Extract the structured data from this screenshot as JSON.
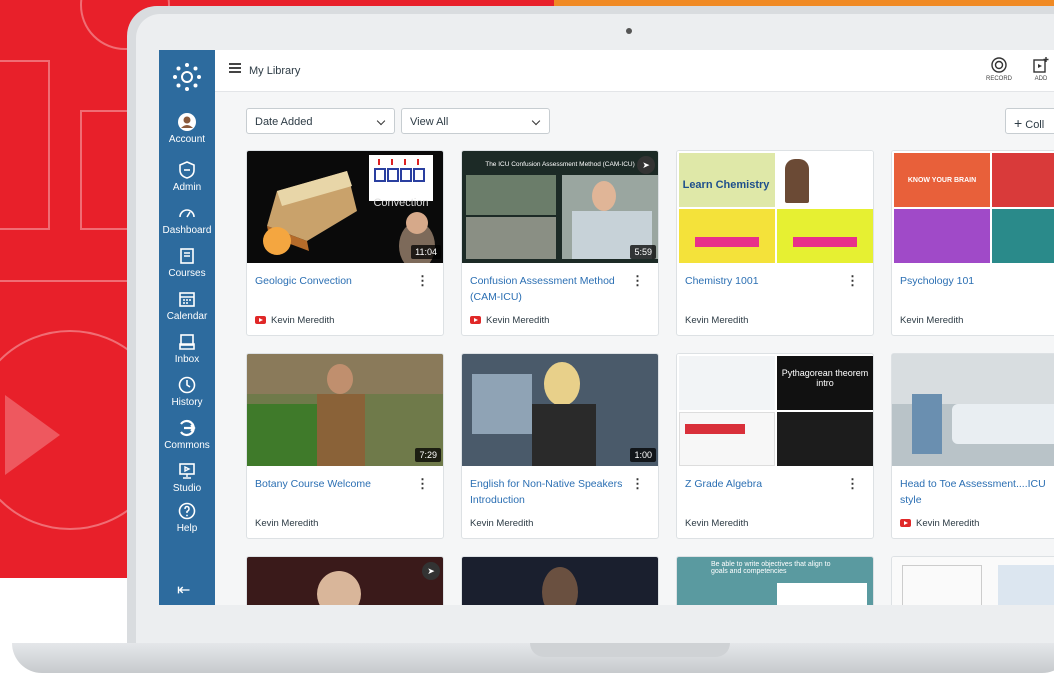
{
  "header": {
    "title": "My Library",
    "record_label": "RECORD",
    "add_label": "ADD"
  },
  "filters": {
    "sort_value": "Date Added",
    "view_value": "View All",
    "collection_label": "Coll"
  },
  "sidebar": {
    "items": [
      {
        "label": "Account",
        "icon": "account-icon"
      },
      {
        "label": "Admin",
        "icon": "admin-icon"
      },
      {
        "label": "Dashboard",
        "icon": "dashboard-icon"
      },
      {
        "label": "Courses",
        "icon": "courses-icon"
      },
      {
        "label": "Calendar",
        "icon": "calendar-icon"
      },
      {
        "label": "Inbox",
        "icon": "inbox-icon"
      },
      {
        "label": "History",
        "icon": "history-icon"
      },
      {
        "label": "Commons",
        "icon": "commons-icon"
      },
      {
        "label": "Studio",
        "icon": "studio-icon"
      },
      {
        "label": "Help",
        "icon": "help-icon"
      }
    ]
  },
  "cards": [
    {
      "title": "Geologic Convection",
      "owner": "Kevin Meredith",
      "duration": "11:04",
      "source": "youtube",
      "thumb_text": "Convection"
    },
    {
      "title": "Confusion Assessment Method (CAM-ICU)",
      "owner": "Kevin Meredith",
      "duration": "5:59",
      "source": "youtube",
      "thumb_text": "The ICU Confusion Assessment Method (CAM-ICU)"
    },
    {
      "title": "Chemistry 1001",
      "owner": "Kevin Meredith",
      "duration": "",
      "source": "",
      "thumb_text": "Learn Chemistry"
    },
    {
      "title": "Psychology 101",
      "owner": "Kevin Meredith",
      "duration": "",
      "source": "",
      "thumb_text": "KNOW YOUR BRAIN"
    },
    {
      "title": "Botany Course Welcome",
      "owner": "Kevin Meredith",
      "duration": "7:29",
      "source": "",
      "thumb_text": ""
    },
    {
      "title": "English for Non-Native Speakers Introduction",
      "owner": "Kevin Meredith",
      "duration": "1:00",
      "source": "",
      "thumb_text": ""
    },
    {
      "title": "Z Grade Algebra",
      "owner": "Kevin Meredith",
      "duration": "",
      "source": "",
      "thumb_text": "Pythagorean theorem intro"
    },
    {
      "title": "Head to Toe Assessment....ICU style",
      "owner": "Kevin Meredith",
      "duration": "",
      "source": "youtube",
      "thumb_text": ""
    }
  ],
  "partial_row_text": "Be able to write objectives that align to goals and competencies",
  "colors": {
    "brand_red": "#e8202a",
    "sidebar_blue": "#2d6b9e",
    "link_blue": "#2b6fb3"
  }
}
